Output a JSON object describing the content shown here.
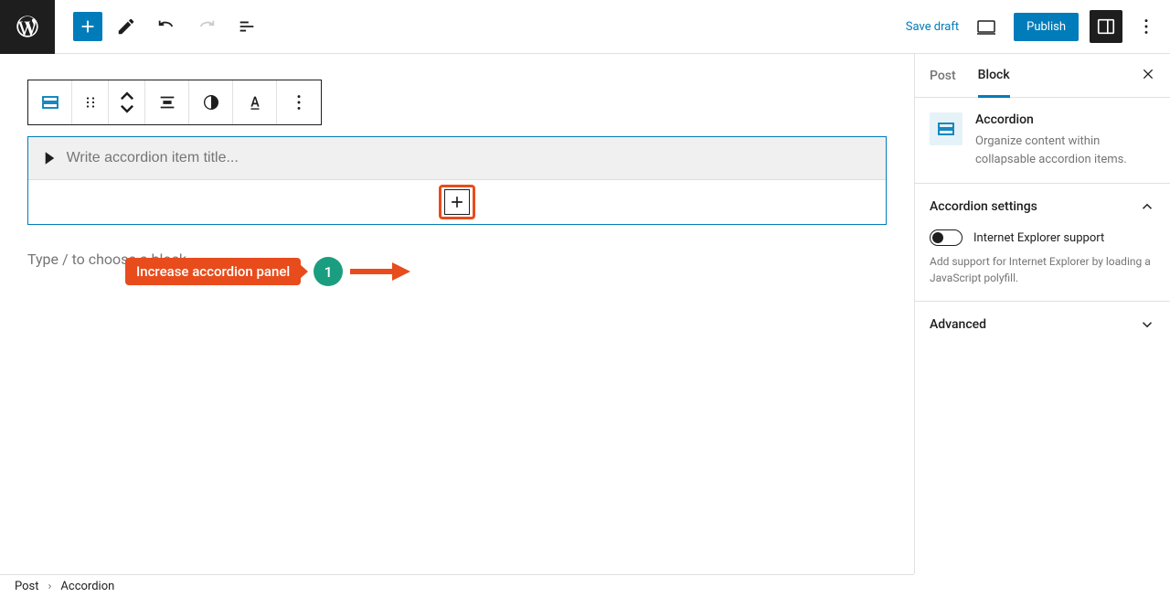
{
  "header": {
    "save_draft": "Save draft",
    "publish": "Publish"
  },
  "accordion": {
    "placeholder": "Write accordion item title..."
  },
  "editorPlaceholder": "Type / to choose a block",
  "annotation": {
    "label": "Increase accordion panel",
    "num": "1"
  },
  "sidebar": {
    "tabs": {
      "post": "Post",
      "block": "Block"
    },
    "block": {
      "title": "Accordion",
      "desc": "Organize content within collapsable accordion items."
    },
    "settings": {
      "title": "Accordion settings",
      "ie_label": "Internet Explorer support",
      "ie_help": "Add support for Internet Explorer by loading a JavaScript polyfill."
    },
    "advanced": "Advanced"
  },
  "breadcrumb": {
    "root": "Post",
    "current": "Accordion"
  }
}
